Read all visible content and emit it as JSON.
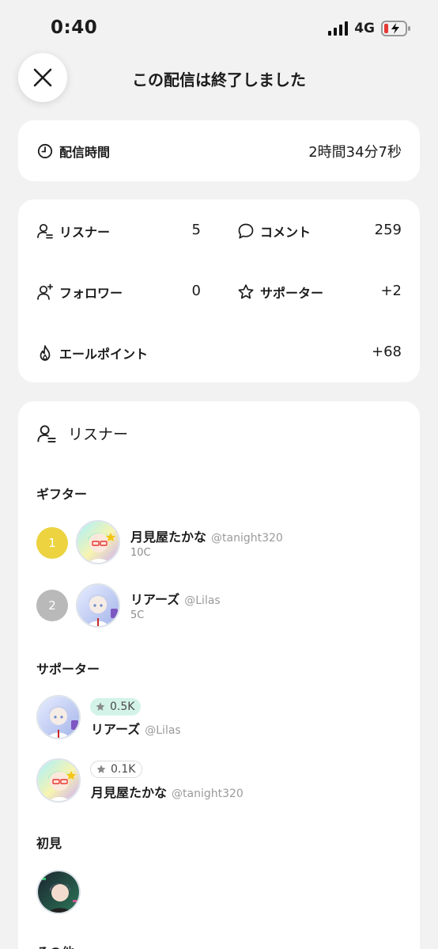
{
  "status": {
    "time": "0:40",
    "network": "4G"
  },
  "header": {
    "title": "この配信は終了しました"
  },
  "duration": {
    "label": "配信時間",
    "value": "2時間34分7秒"
  },
  "stats": {
    "listeners": {
      "label": "リスナー",
      "value": "5"
    },
    "comments": {
      "label": "コメント",
      "value": "259"
    },
    "followers": {
      "label": "フォロワー",
      "value": "0"
    },
    "supporters": {
      "label": "サポーター",
      "value": "+2"
    },
    "yell_points": {
      "label": "エールポイント",
      "value": "+68"
    }
  },
  "listeners_section": {
    "title": "リスナー",
    "gifters_heading": "ギフター",
    "gifters": [
      {
        "rank": "1",
        "name": "月見屋たかな",
        "handle": "@tanight320",
        "coins": "10C"
      },
      {
        "rank": "2",
        "name": "リアーズ",
        "handle": "@Lilas",
        "coins": "5C"
      }
    ],
    "supporters_heading": "サポーター",
    "supporters": [
      {
        "badge": "0.5K",
        "name": "リアーズ",
        "handle": "@Lilas"
      },
      {
        "badge": "0.1K",
        "name": "月見屋たかな",
        "handle": "@tanight320"
      }
    ],
    "first_heading": "初見",
    "other_heading": "その他"
  },
  "colors": {
    "rank1": "#ecd33f",
    "rank2": "#b9b9b9",
    "badge_green": "#d3f3e8"
  }
}
